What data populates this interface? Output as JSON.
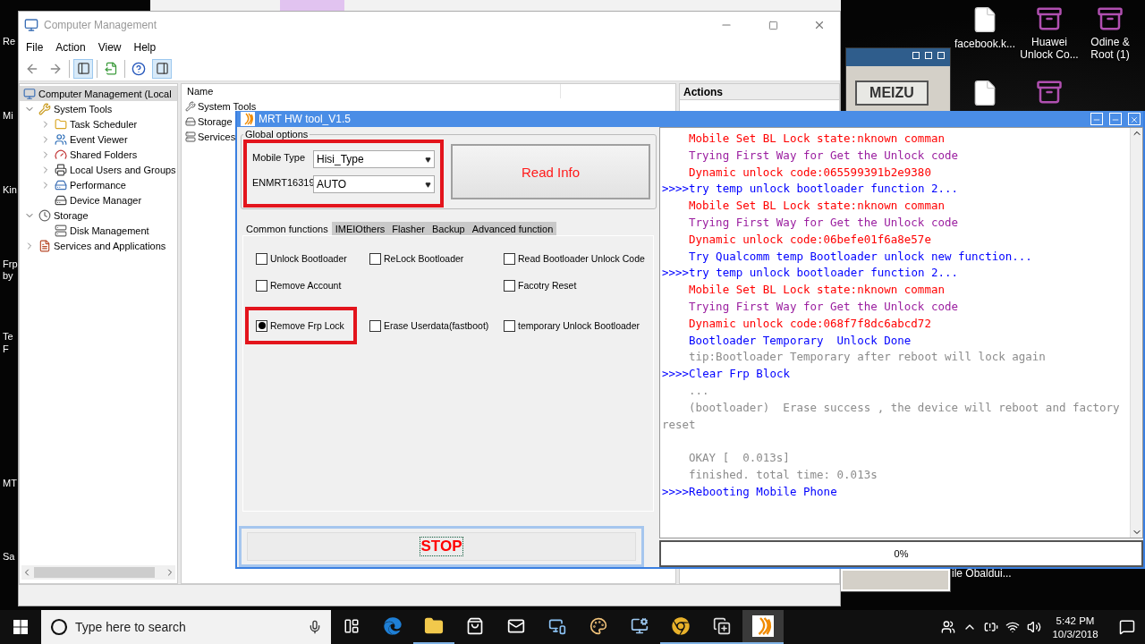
{
  "desktop": {
    "edge_labels": [
      "Re",
      "Mi",
      "Kin",
      "Frp",
      "by",
      "Te",
      "F",
      "MT",
      "Sa"
    ],
    "icons": [
      {
        "kind": "file",
        "label": "facebook.k..."
      },
      {
        "kind": "archive",
        "label": "Huawei Unlock Co..."
      },
      {
        "kind": "archive",
        "label": "Odine & Root (1)"
      },
      {
        "kind": "file"
      },
      {
        "kind": "archive"
      }
    ],
    "partial_label": "ile Obaldui..."
  },
  "meizu_window": {
    "button": "MEIZU"
  },
  "computer_management": {
    "title": "Computer Management",
    "menu": [
      "File",
      "Action",
      "View",
      "Help"
    ],
    "tree": [
      {
        "label": "Computer Management (Local",
        "selected": true,
        "kind": "root",
        "children": [
          {
            "label": "System Tools",
            "selected": false,
            "kind": "branch",
            "expanded": true,
            "children": [
              {
                "label": "Task Scheduler",
                "selected": false,
                "kind": "branch",
                "expanded": false
              },
              {
                "label": "Event Viewer",
                "selected": false,
                "kind": "branch",
                "expanded": false
              },
              {
                "label": "Shared Folders",
                "selected": false,
                "kind": "branch",
                "expanded": false
              },
              {
                "label": "Local Users and Groups",
                "selected": false,
                "kind": "branch",
                "expanded": false
              },
              {
                "label": "Performance",
                "selected": false,
                "kind": "branch",
                "expanded": false
              },
              {
                "label": "Device Manager",
                "selected": false,
                "kind": "leaf"
              }
            ]
          },
          {
            "label": "Storage",
            "selected": false,
            "kind": "branch",
            "expanded": true,
            "children": [
              {
                "label": "Disk Management",
                "selected": false,
                "kind": "leaf"
              }
            ]
          },
          {
            "label": "Services and Applications",
            "selected": false,
            "kind": "branch",
            "expanded": false
          }
        ]
      }
    ],
    "list_header": "Name",
    "list_items": [
      "System Tools",
      "Storage",
      "Services"
    ],
    "actions_header": "Actions"
  },
  "mrt_tool": {
    "title": "MRT HW tool_V1.5",
    "global_options": {
      "legend": "Global options",
      "highlighted": true,
      "fields": [
        {
          "label": "Mobile Type",
          "value": "Hisi_Type"
        },
        {
          "label": "ENMRT16319",
          "value": "AUTO"
        }
      ]
    },
    "read_button": "Read Info",
    "tabs": [
      {
        "label": "Common functions",
        "selected": true
      },
      {
        "label": "IMEIOthers",
        "selected": false
      },
      {
        "label": "Flasher",
        "selected": false
      },
      {
        "label": "Backup",
        "selected": false
      },
      {
        "label": "Advanced function",
        "selected": false
      }
    ],
    "options": [
      {
        "label": "Unlock Bootloader",
        "checked": false,
        "highlighted": false
      },
      {
        "label": "ReLock Bootloader",
        "checked": false,
        "highlighted": false
      },
      {
        "label": "Read Bootloader Unlock Code",
        "checked": false,
        "highlighted": false
      },
      {
        "label": "Remove Account",
        "checked": false,
        "highlighted": false
      },
      {
        "label": "Facotry Reset",
        "checked": false,
        "highlighted": false
      },
      {
        "label": "Remove Frp Lock",
        "checked": true,
        "highlighted": true
      },
      {
        "label": "Erase Userdata(fastboot)",
        "checked": false,
        "highlighted": false
      },
      {
        "label": "temporary Unlock Bootloader",
        "checked": false,
        "highlighted": false
      }
    ],
    "stop_button": "STOP",
    "log": [
      {
        "text": "Mobile Set BL Lock state:nknown comman",
        "color": "#ff0000",
        "indent": true,
        "gap_before": false
      },
      {
        "text": "Trying First Way for Get the Unlock code",
        "color": "#9b1fa0",
        "indent": true,
        "gap_before": false
      },
      {
        "text": "Dynamic unlock code:065599391b2e9380",
        "color": "#ff0000",
        "indent": true,
        "gap_before": false
      },
      {
        "text": ">>>>try temp unlock bootloader function 2...",
        "color": "#0000ff",
        "indent": false,
        "gap_before": false
      },
      {
        "text": "Mobile Set BL Lock state:nknown comman",
        "color": "#ff0000",
        "indent": true,
        "gap_before": false
      },
      {
        "text": "Trying First Way for Get the Unlock code",
        "color": "#9b1fa0",
        "indent": true,
        "gap_before": false
      },
      {
        "text": "Dynamic unlock code:06befe01f6a8e57e",
        "color": "#ff0000",
        "indent": true,
        "gap_before": false
      },
      {
        "text": "Try Qualcomm temp Bootloader unlock new function...",
        "color": "#0000ff",
        "indent": true,
        "gap_before": false
      },
      {
        "text": ">>>>try temp unlock bootloader function 2...",
        "color": "#0000ff",
        "indent": false,
        "gap_before": false
      },
      {
        "text": "Mobile Set BL Lock state:nknown comman",
        "color": "#ff0000",
        "indent": true,
        "gap_before": false
      },
      {
        "text": "Trying First Way for Get the Unlock code",
        "color": "#9b1fa0",
        "indent": true,
        "gap_before": false
      },
      {
        "text": "Dynamic unlock code:068f7f8dc6abcd72",
        "color": "#ff0000",
        "indent": true,
        "gap_before": false
      },
      {
        "text": "Bootloader Temporary  Unlock Done",
        "color": "#0000ff",
        "indent": true,
        "gap_before": false
      },
      {
        "text": "tip:Bootloader Temporary after reboot will lock again",
        "color": "#8c8c8c",
        "indent": true,
        "gap_before": false
      },
      {
        "text": ">>>>Clear Frp Block",
        "color": "#0000ff",
        "indent": false,
        "gap_before": false
      },
      {
        "text": "...",
        "color": "#8c8c8c",
        "indent": true,
        "gap_before": false
      },
      {
        "text": "(bootloader)  Erase success , the device will reboot and factory",
        "color": "#8c8c8c",
        "indent": true,
        "gap_before": false
      },
      {
        "text": "reset",
        "color": "#8c8c8c",
        "indent": false,
        "gap_before": false
      },
      {
        "text": "OKAY [  0.013s]",
        "color": "#8c8c8c",
        "indent": true,
        "gap_before": true
      },
      {
        "text": "finished. total time: 0.013s",
        "color": "#8c8c8c",
        "indent": true,
        "gap_before": false
      },
      {
        "text": ">>>>Rebooting Mobile Phone",
        "color": "#0000ff",
        "indent": false,
        "gap_before": false
      }
    ],
    "progress": {
      "level": 0,
      "reading": "0%"
    }
  },
  "taskbar": {
    "search": {
      "placeholder": "Type here to search"
    },
    "apps": [
      {
        "running": false,
        "active": false
      },
      {
        "running": true,
        "active": false
      },
      {
        "running": false,
        "active": false
      },
      {
        "running": false,
        "active": false
      },
      {
        "running": false,
        "active": false
      },
      {
        "running": false,
        "active": false
      },
      {
        "running": false,
        "active": false
      },
      {
        "running": true,
        "active": false
      },
      {
        "running": true,
        "active": false
      },
      {
        "running": true,
        "active": true
      }
    ],
    "time": "5:42 PM",
    "date": "10/3/2018"
  }
}
